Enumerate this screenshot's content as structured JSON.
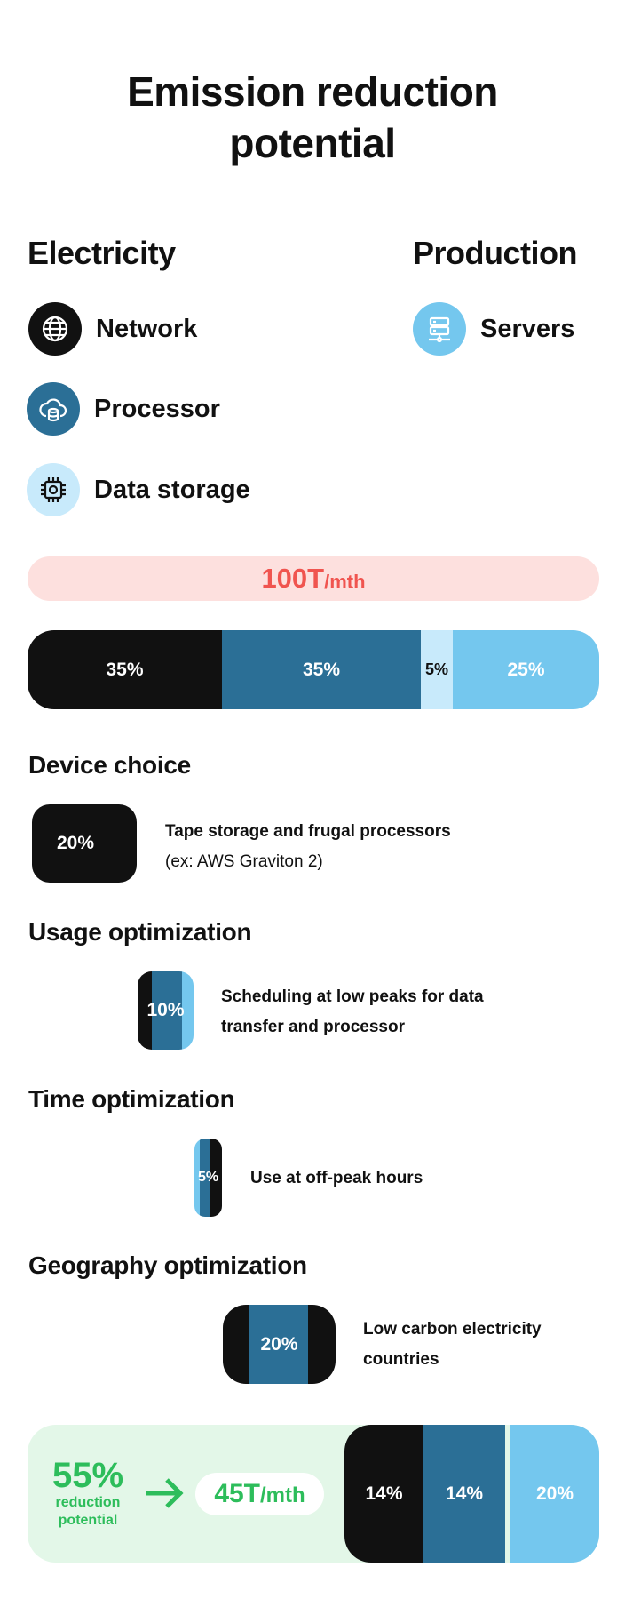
{
  "title_line1": "Emission reduction",
  "title_line2": "potential",
  "electricity": {
    "heading": "Electricity",
    "items": [
      {
        "label": "Network",
        "icon": "globe-icon",
        "color": "#111111"
      },
      {
        "label": "Processor",
        "icon": "cloud-database-icon",
        "color": "#2b6f96"
      },
      {
        "label": "Data storage",
        "icon": "chip-icon",
        "color": "#c8eafb"
      }
    ]
  },
  "production": {
    "heading": "Production",
    "items": [
      {
        "label": "Servers",
        "icon": "server-icon",
        "color": "#74c7ee"
      }
    ]
  },
  "total": {
    "value": "100T",
    "unit": "/mth",
    "color": "#f0544f"
  },
  "breakdown": [
    {
      "label": "35%",
      "value": 35,
      "color": "#111111"
    },
    {
      "label": "35%",
      "value": 35,
      "color": "#2b6f96"
    },
    {
      "label": "5%",
      "value": 5,
      "color": "#c8eafb"
    },
    {
      "label": "25%",
      "value": 25,
      "color": "#74c7ee"
    }
  ],
  "sections": [
    {
      "heading": "Device choice",
      "pct": "20%",
      "line1": "Tape storage and frugal processors",
      "line2": "(ex: AWS Graviton 2)"
    },
    {
      "heading": "Usage optimization",
      "pct": "10%",
      "line1": "Scheduling at low peaks for data",
      "line2": "transfer and processor"
    },
    {
      "heading": "Time optimization",
      "pct": "5%",
      "line1": "Use at off-peak hours"
    },
    {
      "heading": "Geography optimization",
      "pct": "20%",
      "line1": "Low carbon electricity",
      "line2": "countries"
    }
  ],
  "result": {
    "reduction": "55%",
    "reduction_label1": "reduction",
    "reduction_label2": "potential",
    "new_total": "45T",
    "new_unit": "/mth",
    "color": "#2dbd5b",
    "segments": [
      {
        "label": "14%",
        "color": "#111111"
      },
      {
        "label": "14%",
        "color": "#2b6f96"
      },
      {
        "label": "20%",
        "color": "#74c7ee"
      }
    ]
  }
}
